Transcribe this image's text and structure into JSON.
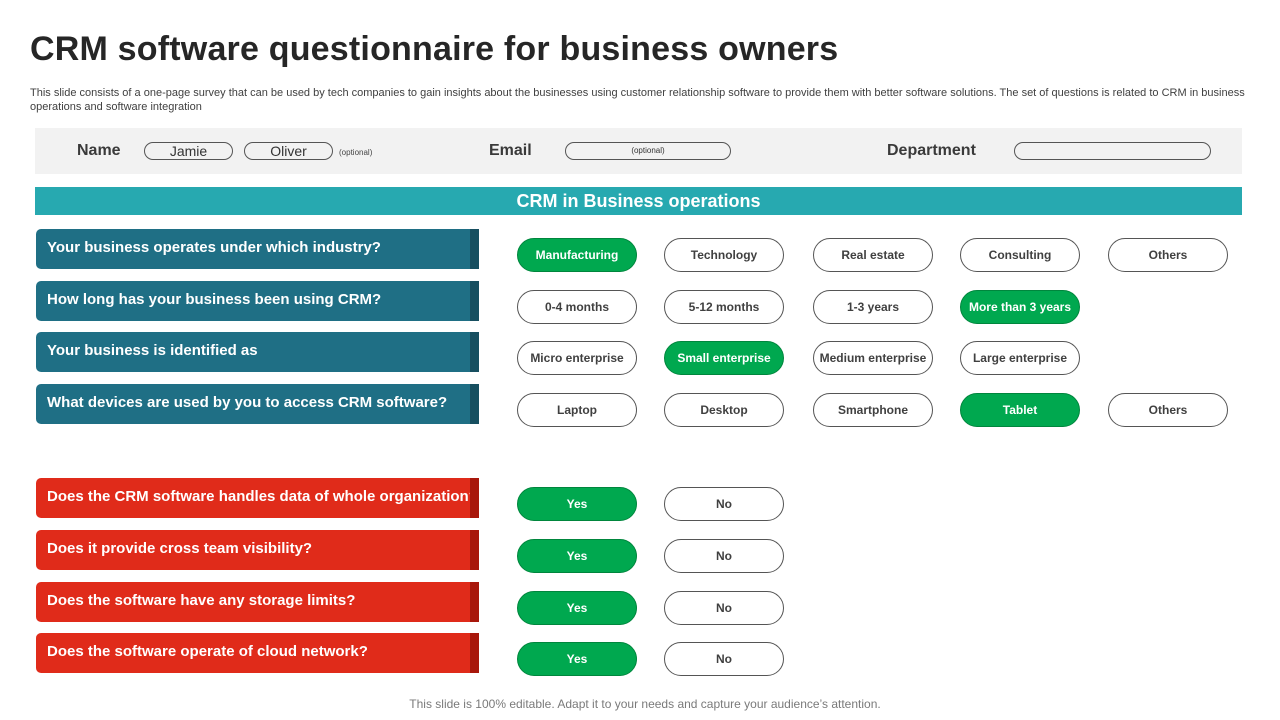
{
  "title": "CRM software questionnaire for business owners",
  "subtitle": "This slide consists of a one-page survey that can be used by tech companies to gain insights about the businesses using customer relationship software to provide them with better software solutions. The set of questions is related to CRM in business operations and software integration",
  "info": {
    "name_label": "Name",
    "first_name": "Jamie",
    "last_name": "Oliver",
    "name_optional": "(optional)",
    "email_label": "Email",
    "email_optional": "(optional)",
    "department_label": "Department",
    "department_value": ""
  },
  "section_title": "CRM in Business operations",
  "questions": [
    {
      "text": "Your business operates under which industry?",
      "options": [
        "Manufacturing",
        "Technology",
        "Real estate",
        "Consulting",
        "Others"
      ],
      "selected": 0
    },
    {
      "text": "How long has your business been using CRM?",
      "options": [
        "0-4 months",
        "5-12 months",
        "1-3 years",
        "More than 3 years"
      ],
      "selected": 3
    },
    {
      "text": "Your business is identified as",
      "options": [
        "Micro enterprise",
        "Small enterprise",
        "Medium enterprise",
        "Large enterprise"
      ],
      "selected": 1
    },
    {
      "text": "What devices are used by you to access CRM software?",
      "options": [
        "Laptop",
        "Desktop",
        "Smartphone",
        "Tablet",
        "Others"
      ],
      "selected": 3
    },
    {
      "text": "Does the CRM software handles data of whole organization?",
      "options": [
        "Yes",
        "No"
      ],
      "selected": 0
    },
    {
      "text": "Does it provide cross team visibility?",
      "options": [
        "Yes",
        "No"
      ],
      "selected": 0
    },
    {
      "text": "Does the software have any storage limits?",
      "options": [
        "Yes",
        "No"
      ],
      "selected": 0
    },
    {
      "text": "Does the software operate of cloud network?",
      "options": [
        "Yes",
        "No"
      ],
      "selected": 0
    }
  ],
  "colors": {
    "section_bar": "#27a9b0",
    "question_teal": "#1f6f85",
    "question_red": "#e02b1a",
    "selected_green": "#00a84f"
  },
  "footer": "This slide is 100% editable. Adapt it to your needs and capture your audience’s attention."
}
